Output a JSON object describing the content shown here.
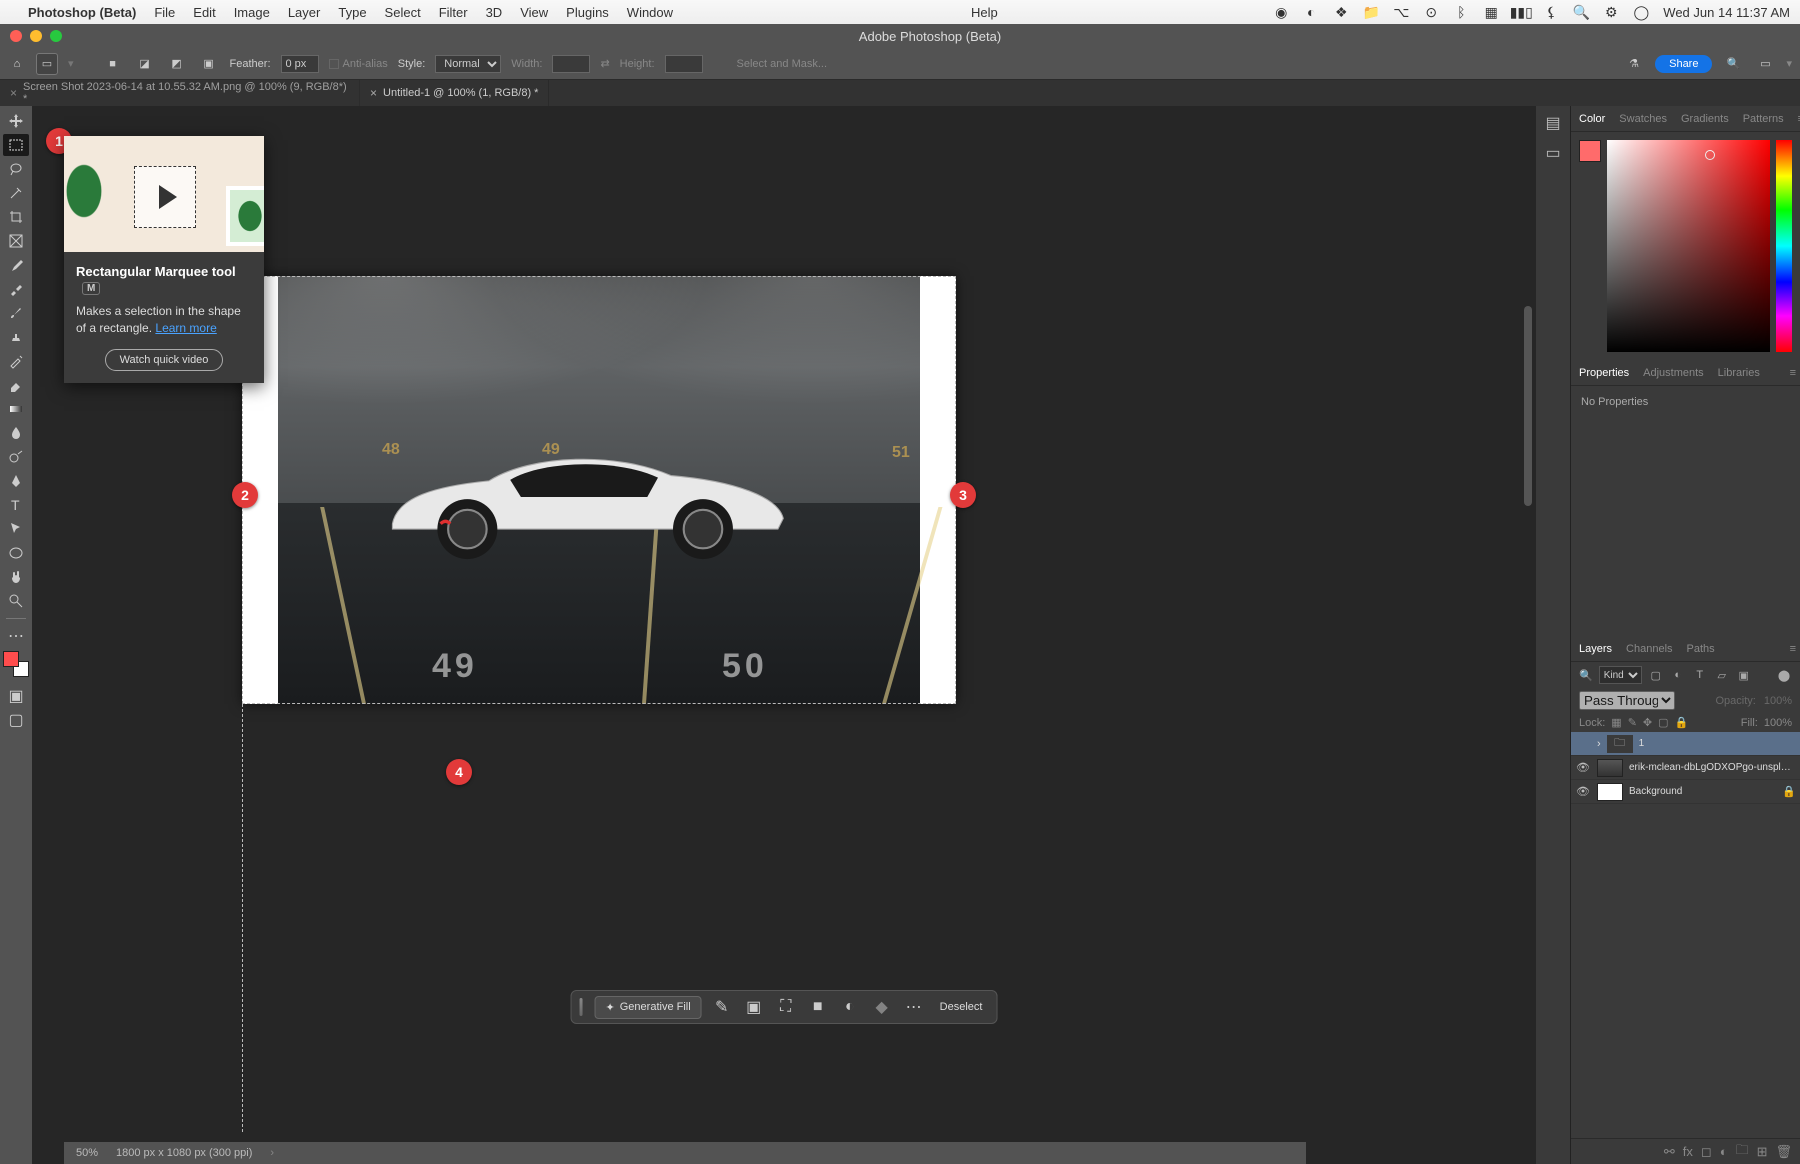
{
  "mac_menu": {
    "app": "Photoshop (Beta)",
    "items": [
      "File",
      "Edit",
      "Image",
      "Layer",
      "Type",
      "Select",
      "Filter",
      "3D",
      "View",
      "Plugins",
      "Window"
    ],
    "help": "Help",
    "clock": "Wed Jun 14  11:37 AM"
  },
  "window_title": "Adobe Photoshop (Beta)",
  "options_bar": {
    "feather_label": "Feather:",
    "feather_value": "0 px",
    "antialias": "Anti-alias",
    "style_label": "Style:",
    "style_value": "Normal",
    "width_label": "Width:",
    "height_label": "Height:",
    "select_mask": "Select and Mask...",
    "share": "Share"
  },
  "tabs": [
    {
      "label": "Screen Shot 2023-06-14 at 10.55.32 AM.png @ 100% (9, RGB/8*) *"
    },
    {
      "label": "Untitled-1 @ 100% (1, RGB/8) *"
    }
  ],
  "tooltip": {
    "title": "Rectangular Marquee tool",
    "key": "M",
    "desc": "Makes a selection in the shape of a rectangle. ",
    "learn": "Learn more",
    "button": "Watch quick video"
  },
  "contextual_bar": {
    "gen_fill": "Generative Fill",
    "deselect": "Deselect"
  },
  "status": {
    "zoom": "50%",
    "dims": "1800 px x 1080 px (300 ppi)"
  },
  "panels": {
    "color_tabs": [
      "Color",
      "Swatches",
      "Gradients",
      "Patterns"
    ],
    "props_tabs": [
      "Properties",
      "Adjustments",
      "Libraries"
    ],
    "props_empty": "No Properties",
    "layers_tabs": [
      "Layers",
      "Channels",
      "Paths"
    ],
    "layers_filter": "Kind",
    "layers_blend": "Pass Through",
    "layers_opacity_label": "Opacity:",
    "layers_opacity_val": "100%",
    "layers_lock_label": "Lock:",
    "layers_fill_label": "Fill:",
    "layers_fill_val": "100%",
    "layers_items": [
      {
        "name": "1",
        "type": "group",
        "selected": true
      },
      {
        "name": "erik-mclean-dbLgODXOPgo-unsplash",
        "type": "image"
      },
      {
        "name": "Background",
        "type": "bg",
        "locked": true
      }
    ]
  },
  "scene": {
    "wall_numbers": [
      "48",
      "49",
      "51"
    ],
    "floor_numbers": [
      "49",
      "50"
    ]
  },
  "annotations": [
    "1",
    "2",
    "3",
    "4"
  ]
}
